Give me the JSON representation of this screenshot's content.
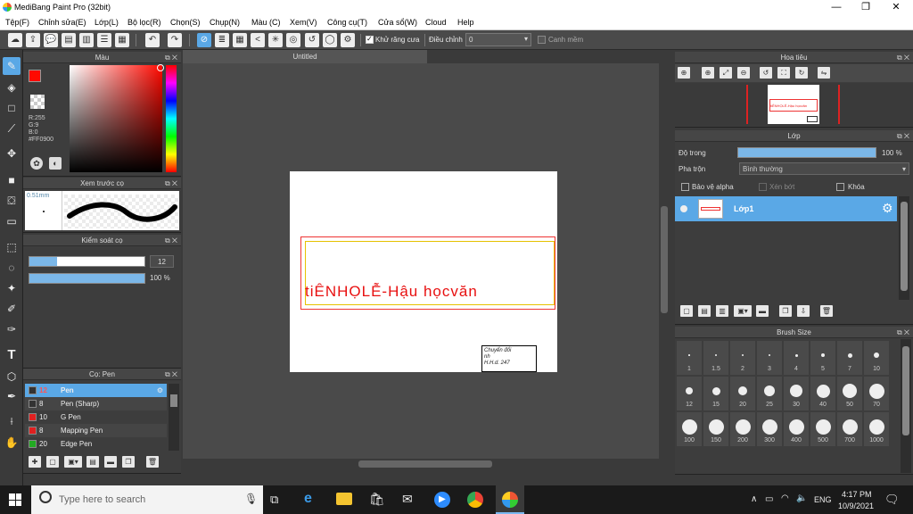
{
  "window": {
    "title": "MediBang Paint Pro (32bit)",
    "minimize": "—",
    "maximize": "❐",
    "close": "✕"
  },
  "menu": [
    "Tệp(F)",
    "Chỉnh sửa(E)",
    "Lớp(L)",
    "Bộ lọc(R)",
    "Chọn(S)",
    "Chụp(N)",
    "Màu (C)",
    "Xem(V)",
    "Công cụ(T)",
    "Cửa sổ(W)",
    "Cloud",
    "Help"
  ],
  "toolbar": {
    "antialias_label": "Khử răng cưa",
    "adjust_label": "Điều chỉnh",
    "adjust_value": "0",
    "snap_label": "Canh mềm"
  },
  "color_panel": {
    "title": "Màu",
    "r": "R:255",
    "g": "G:9",
    "b": "B:0",
    "hex": "#FF0900",
    "primary_color": "#ff0900"
  },
  "brush_preview": {
    "title": "Xem trước cọ",
    "size": "0.51mm"
  },
  "brush_control": {
    "title": "Kiểm soát cọ",
    "size_value": "12",
    "opacity_value": "100 %",
    "size_fill": 0.24,
    "opacity_fill": 1.0
  },
  "brush_list": {
    "title": "Cọ: Pen",
    "items": [
      {
        "num": "12",
        "name": "Pen",
        "color": "#333333",
        "selected": true
      },
      {
        "num": "8",
        "name": "Pen (Sharp)",
        "color": "#333333",
        "selected": false
      },
      {
        "num": "10",
        "name": "G Pen",
        "color": "#e02020",
        "selected": false
      },
      {
        "num": "8",
        "name": "Mapping Pen",
        "color": "#e02020",
        "selected": false
      },
      {
        "num": "20",
        "name": "Edge Pen",
        "color": "#22aa22",
        "selected": false
      }
    ]
  },
  "document": {
    "tab": "Untitled",
    "text": "tiÊNHỌLỄ-Hậu họcvăn",
    "note_line1": "Chuyển đổi",
    "note_line2": "nh",
    "note_line3": "H.H.d. 247"
  },
  "navigator": {
    "title": "Hoa tiêu",
    "thumb_text": "tiÊNHỌLÊ-Hậu họcvăn"
  },
  "layer_panel": {
    "title": "Lớp",
    "opacity_label": "Độ trong",
    "opacity_value": "100 %",
    "opacity_fill": 1.0,
    "blend_label": "Pha trộn",
    "blend_value": "Bình thường",
    "protect_alpha": "Bảo vệ alpha",
    "clipping": "Xén bớt",
    "lock": "Khóa",
    "layer_name": "Lớp1"
  },
  "brush_size": {
    "title": "Brush Size",
    "sizes": [
      "1",
      "1.5",
      "2",
      "3",
      "4",
      "5",
      "7",
      "10",
      "12",
      "15",
      "20",
      "25",
      "30",
      "40",
      "50",
      "70",
      "100",
      "150",
      "200",
      "300",
      "400",
      "500",
      "700",
      "1000"
    ]
  },
  "taskbar": {
    "search_placeholder": "Type here to search",
    "lang": "ENG",
    "time": "4:17 PM",
    "date": "10/9/2021"
  }
}
